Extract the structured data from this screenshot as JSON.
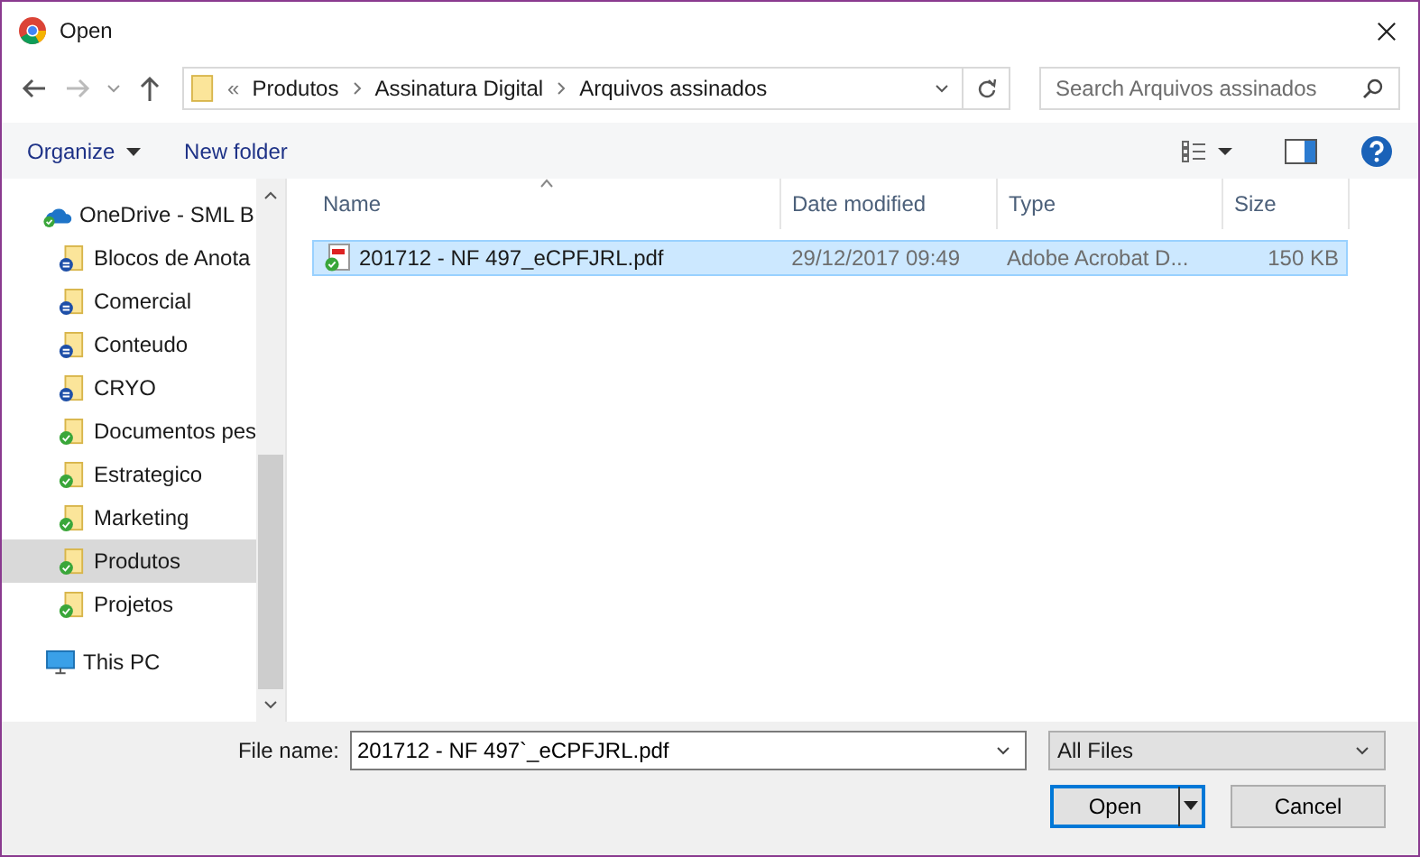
{
  "window": {
    "title": "Open"
  },
  "address": {
    "chevron": "«",
    "crumbs": [
      "Produtos",
      "Assinatura Digital",
      "Arquivos assinados"
    ]
  },
  "search": {
    "placeholder": "Search Arquivos assinados"
  },
  "toolbar": {
    "organize": "Organize",
    "new_folder": "New folder"
  },
  "sidebar": {
    "root": {
      "label": "OneDrive - SML B",
      "kind": "synced",
      "children": [
        {
          "label": "Blocos de Anota",
          "kind": "syncing",
          "selected": false
        },
        {
          "label": "Comercial",
          "kind": "syncing",
          "selected": false
        },
        {
          "label": "Conteudo",
          "kind": "syncing",
          "selected": false
        },
        {
          "label": "CRYO",
          "kind": "syncing",
          "selected": false
        },
        {
          "label": "Documentos pes",
          "kind": "synced",
          "selected": false
        },
        {
          "label": "Estrategico",
          "kind": "synced",
          "selected": false
        },
        {
          "label": "Marketing",
          "kind": "synced",
          "selected": false
        },
        {
          "label": "Produtos",
          "kind": "synced",
          "selected": true
        },
        {
          "label": "Projetos",
          "kind": "synced",
          "selected": false
        }
      ]
    },
    "this_pc": "This PC"
  },
  "table": {
    "columns": [
      "Name",
      "Date modified",
      "Type",
      "Size"
    ],
    "rows": [
      {
        "name": "201712 - NF 497_eCPFJRL.pdf",
        "date": "29/12/2017 09:49",
        "type": "Adobe Acrobat D...",
        "size": "150 KB",
        "selected": true
      }
    ]
  },
  "footer": {
    "file_name_label": "File name:",
    "file_name": "201712 - NF 497`_eCPFJRL.pdf",
    "filter": "All Files",
    "open": "Open",
    "cancel": "Cancel"
  }
}
